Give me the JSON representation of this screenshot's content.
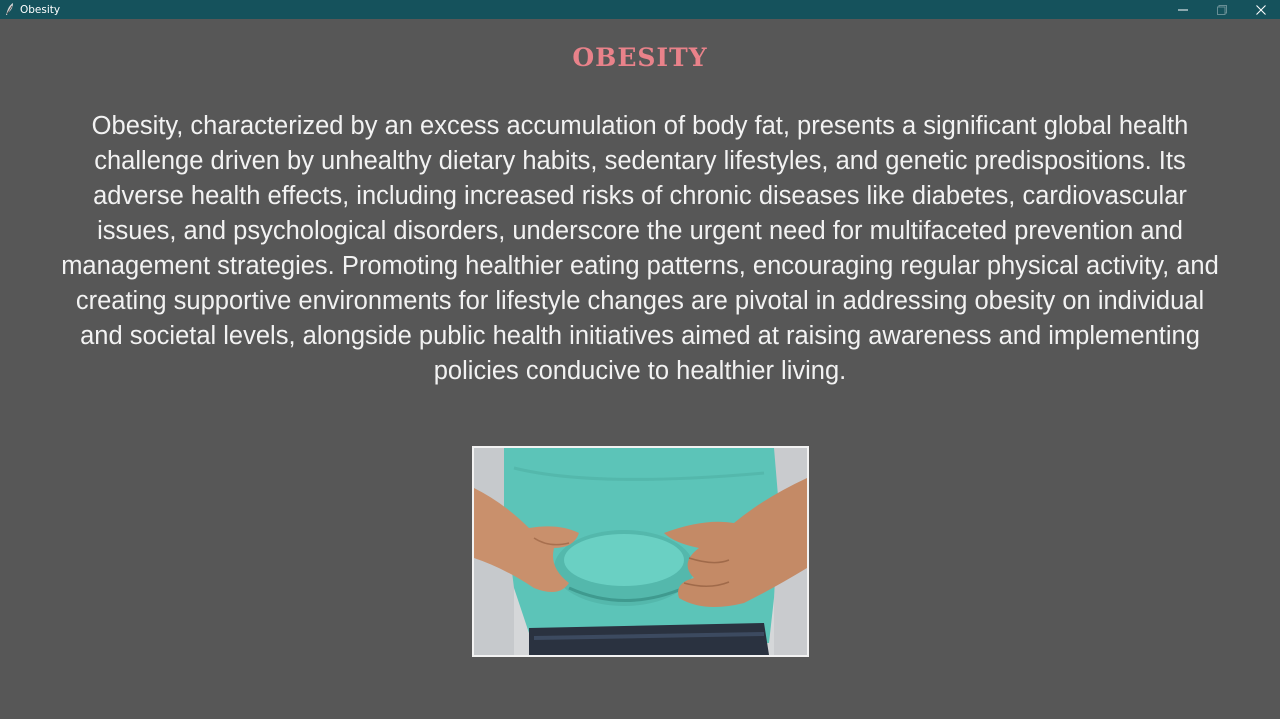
{
  "window": {
    "title": "Obesity",
    "icon": "feather-pen-icon",
    "controls": [
      "minimize-icon",
      "maximize-icon",
      "close-icon"
    ]
  },
  "main": {
    "heading": "Obesity",
    "description": "Obesity, characterized by an excess accumulation of body fat, presents a significant global health challenge driven by unhealthy dietary habits, sedentary lifestyles, and genetic predispositions. Its adverse health effects, including increased risks of chronic diseases like diabetes, cardiovascular issues, and psychological disorders, underscore the urgent need for multifaceted prevention and management strategies. Promoting healthier eating patterns, encouraging regular physical activity, and creating supportive environments for lifestyle changes are pivotal in addressing obesity on individual and societal levels, alongside public health initiatives aimed at raising awareness and implementing policies conducive to healthier living."
  },
  "colors": {
    "titlebar": "#15525c",
    "background": "#575757",
    "heading": "#e9828a",
    "text": "#f2f2f2",
    "shirt": "#5cc4b8"
  }
}
